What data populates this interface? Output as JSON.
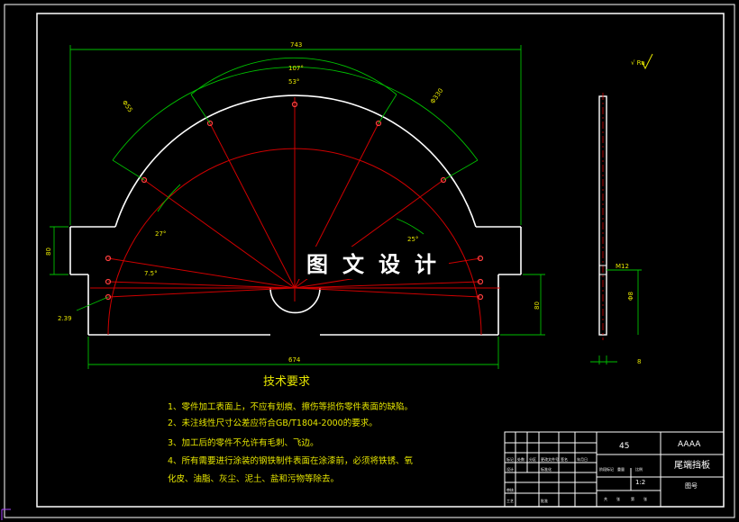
{
  "watermark": [
    "图",
    "文",
    "设",
    "计"
  ],
  "dimensions": {
    "overall_width": "743",
    "arc_angle_large": "107°",
    "arc_angle_small": "53°",
    "radius_left": "Φ55",
    "radius_right": "Φ330",
    "angle_27": "27°",
    "angle_7_5": "7.5°",
    "angle_right": "25°",
    "height_left": "80",
    "height_right": "80",
    "offset_left": "2.39",
    "bottom_width": "674",
    "side_hole": "Φ8",
    "side_thickness": "8",
    "side_note": "M12"
  },
  "roughness_note": "√ Ra",
  "tech_requirements": {
    "title": "技术要求",
    "items": [
      "1、零件加工表面上，不应有划痕、擦伤等损伤零件表面的缺陷。",
      "2、未注线性尺寸公差应符合GB/T1804-2000的要求。",
      "3、加工后的零件不允许有毛刺、飞边。",
      "4、所有需要进行涂装的钢铁制件表面在涂漆前，必须将铁锈、氧",
      "化皮、油脂、灰尘、泥土、盐和污物等除去。"
    ]
  },
  "title_block": {
    "material": "45",
    "company": "AAAA",
    "part_name": "尾端挡板",
    "scale": "1:2",
    "drawing_no": "图号",
    "small_labels": [
      "标记",
      "处数",
      "分区",
      "更改文件号",
      "签名",
      "年月日",
      "设计",
      "标准化",
      "阶段标记",
      "重量",
      "比例",
      "审核",
      "工艺",
      "批准",
      "共",
      "张",
      "第",
      "张"
    ]
  },
  "colors": {
    "background": "#000000",
    "outline": "#ffffff",
    "centerline": "#d00000",
    "dimension": "#00c000",
    "text": "#e6e600"
  }
}
